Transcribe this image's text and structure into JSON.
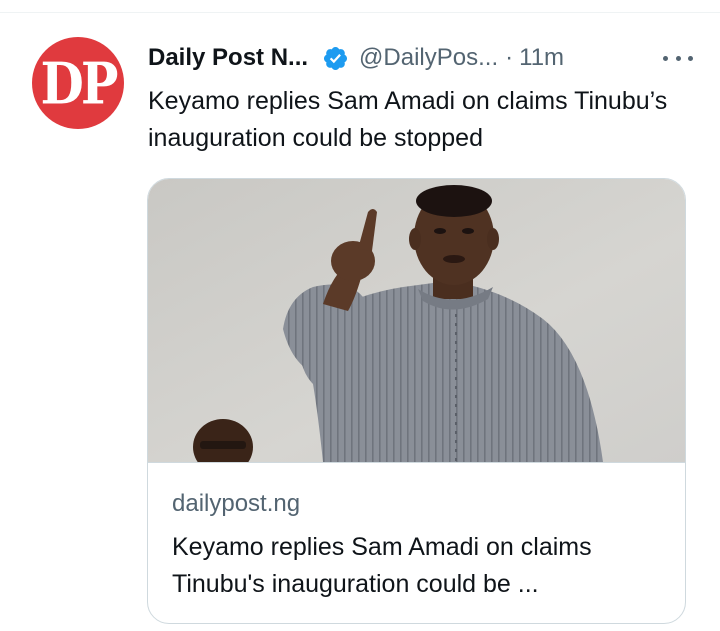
{
  "tweet": {
    "avatar_text": "DP",
    "display_name": "Daily Post N...",
    "handle": "@DailyPos...",
    "separator": "·",
    "time": "11m",
    "text": "Keyamo replies Sam Amadi on claims Tinubu’s inauguration could be stopped",
    "verified_icon": "verified-badge-icon",
    "more_icon": "more-options-icon"
  },
  "card": {
    "domain": "dailypost.ng",
    "title": "Keyamo replies Sam Amadi on claims Tinubu's inauguration could be ..."
  },
  "colors": {
    "brand_red": "#e03a3e",
    "verified_blue": "#1d9bf0",
    "secondary_text": "#536471",
    "primary_text": "#0f1419",
    "card_border": "#cfd9de"
  }
}
